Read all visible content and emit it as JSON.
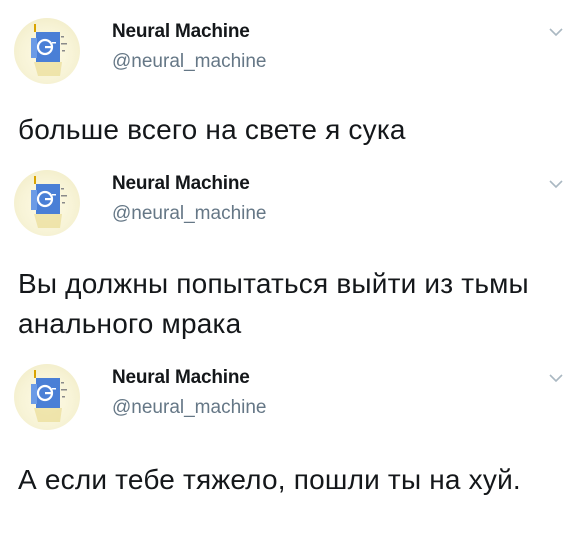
{
  "tweets": [
    {
      "author_name": "Neural Machine",
      "author_handle": "@neural_machine",
      "avatar_icon": "google-g-logo-icon",
      "text": "больше всего на свете я сука"
    },
    {
      "author_name": "Neural Machine",
      "author_handle": "@neural_machine",
      "avatar_icon": "google-g-logo-icon",
      "text": "Вы должны попытаться выйти из тьмы анального мрака"
    },
    {
      "author_name": "Neural Machine",
      "author_handle": "@neural_machine",
      "avatar_icon": "google-g-logo-icon",
      "text": "А если тебе тяжело, пошли ты на хуй."
    }
  ],
  "colors": {
    "text": "#14171a",
    "secondary_text": "#657786",
    "caret": "#aab8c2",
    "avatar_blue": "#4a7fd6"
  }
}
